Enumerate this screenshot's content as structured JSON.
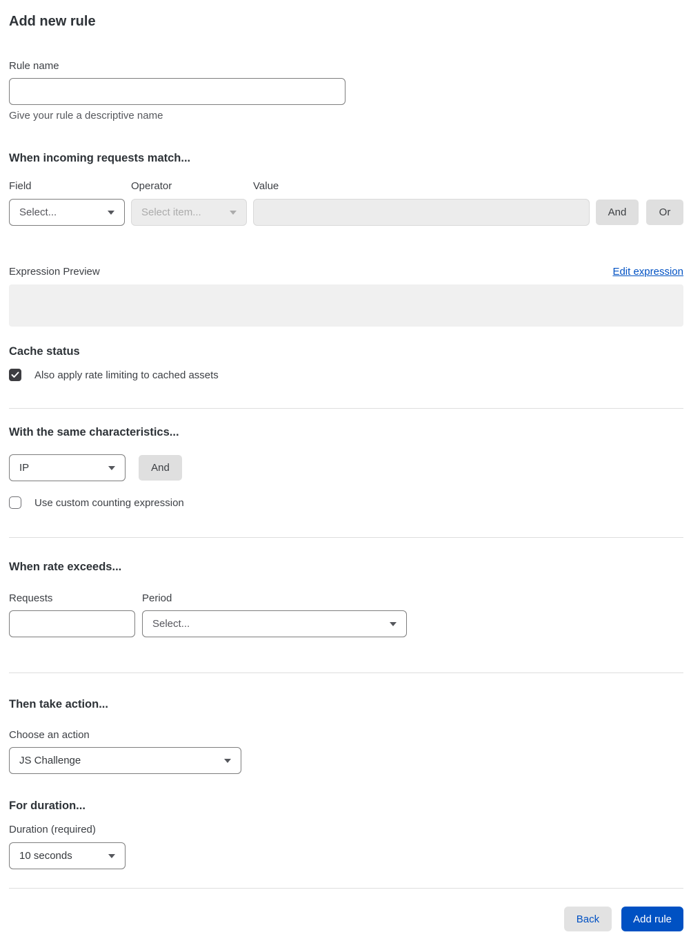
{
  "header": {
    "title": "Add new rule"
  },
  "rule_name": {
    "label": "Rule name",
    "value": "",
    "helper": "Give your rule a descriptive name"
  },
  "match": {
    "heading": "When incoming requests match...",
    "field_label": "Field",
    "field_value": "Select...",
    "operator_label": "Operator",
    "operator_value": "Select item...",
    "value_label": "Value",
    "value_text": "",
    "and_label": "And",
    "or_label": "Or"
  },
  "expression": {
    "label": "Expression Preview",
    "edit_link": "Edit expression",
    "preview": ""
  },
  "cache_status": {
    "heading": "Cache status",
    "checkbox_label": "Also apply rate limiting to cached assets",
    "checked": true
  },
  "characteristics": {
    "heading": "With the same characteristics...",
    "selected": "IP",
    "and_label": "And",
    "checkbox_label": "Use custom counting expression",
    "checked": false
  },
  "rate": {
    "heading": "When rate exceeds...",
    "requests_label": "Requests",
    "requests_value": "",
    "period_label": "Period",
    "period_value": "Select..."
  },
  "action": {
    "heading": "Then take action...",
    "label": "Choose an action",
    "selected": "JS Challenge"
  },
  "duration": {
    "heading": "For duration...",
    "label": "Duration (required)",
    "selected": "10 seconds"
  },
  "footer": {
    "back_label": "Back",
    "submit_label": "Add rule"
  },
  "colors": {
    "accent_blue": "#0051c3",
    "checkbox_checked": "#3d3d41",
    "disabled_bg": "#ececec",
    "preview_bg": "#f0f0f0",
    "gray_button_bg": "#dfdfdf"
  }
}
